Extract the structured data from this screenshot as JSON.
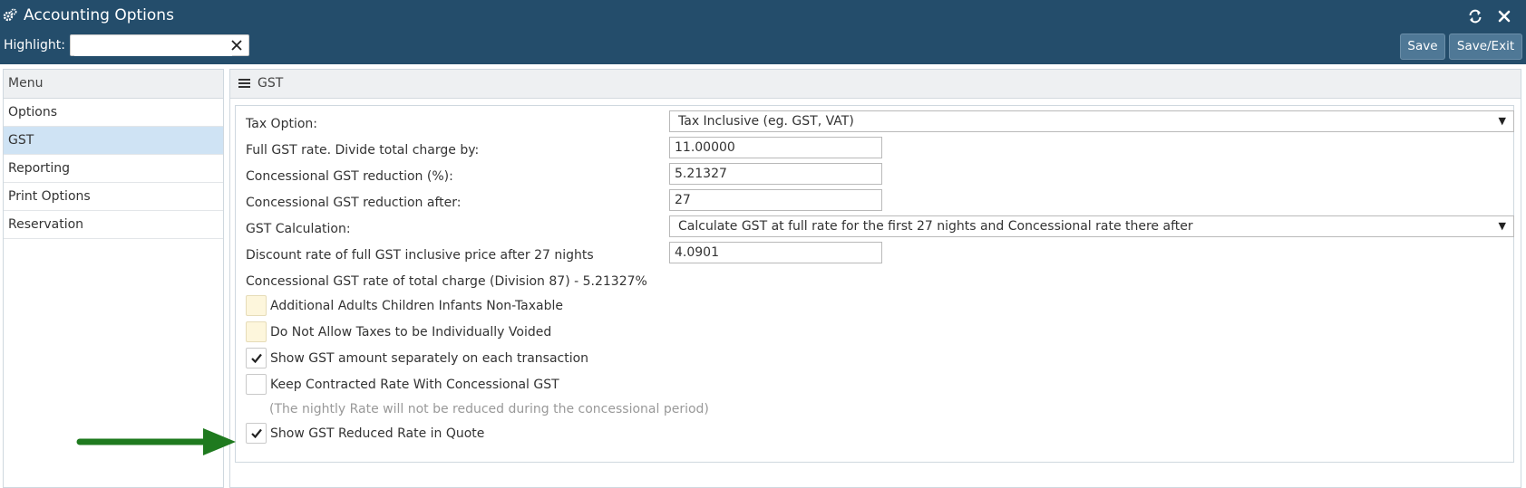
{
  "window": {
    "title": "Accounting Options",
    "refresh_icon": "refresh-icon",
    "close_icon": "close-icon"
  },
  "toolbar": {
    "highlight_label": "Highlight:",
    "highlight_value": "",
    "save_label": "Save",
    "save_exit_label": "Save/Exit"
  },
  "sidebar": {
    "header": "Menu",
    "items": [
      {
        "label": "Options",
        "active": false
      },
      {
        "label": "GST",
        "active": true
      },
      {
        "label": "Reporting",
        "active": false
      },
      {
        "label": "Print Options",
        "active": false
      },
      {
        "label": "Reservation",
        "active": false
      }
    ]
  },
  "panel": {
    "title": "GST",
    "fields": {
      "tax_option": {
        "label": "Tax Option:",
        "value": "Tax Inclusive (eg. GST, VAT)"
      },
      "full_gst_rate": {
        "label": "Full GST rate. Divide total charge by:",
        "value": "11.00000"
      },
      "concessional_reduction": {
        "label": "Concessional GST reduction (%):",
        "value": "5.21327"
      },
      "concessional_after": {
        "label": "Concessional GST reduction after:",
        "value": "27"
      },
      "gst_calculation": {
        "label": "GST Calculation:",
        "value": "Calculate GST at full rate for the first 27 nights and Concessional rate there after"
      },
      "discount_rate": {
        "label": "Discount rate of full GST inclusive price after 27 nights",
        "value": "4.0901"
      }
    },
    "concessional_info": "Concessional GST rate of total charge (Division 87) - 5.21327%",
    "checkboxes": [
      {
        "label": "Additional Adults Children Infants Non-Taxable",
        "checked": false
      },
      {
        "label": "Do Not Allow Taxes to be Individually Voided",
        "checked": false
      },
      {
        "label": "Show GST amount separately on each transaction",
        "checked": true
      },
      {
        "label": "Keep Contracted Rate With Concessional GST",
        "checked": false
      },
      {
        "label": "Show GST Reduced Rate in Quote",
        "checked": true
      }
    ],
    "contracted_note": "(The nightly Rate will not be reduced during the concessional period)"
  },
  "colors": {
    "titlebar": "#244d6b",
    "button": "#4f7896",
    "active_menu": "#cfe3f4",
    "annotation_arrow": "#1f7a1f"
  }
}
